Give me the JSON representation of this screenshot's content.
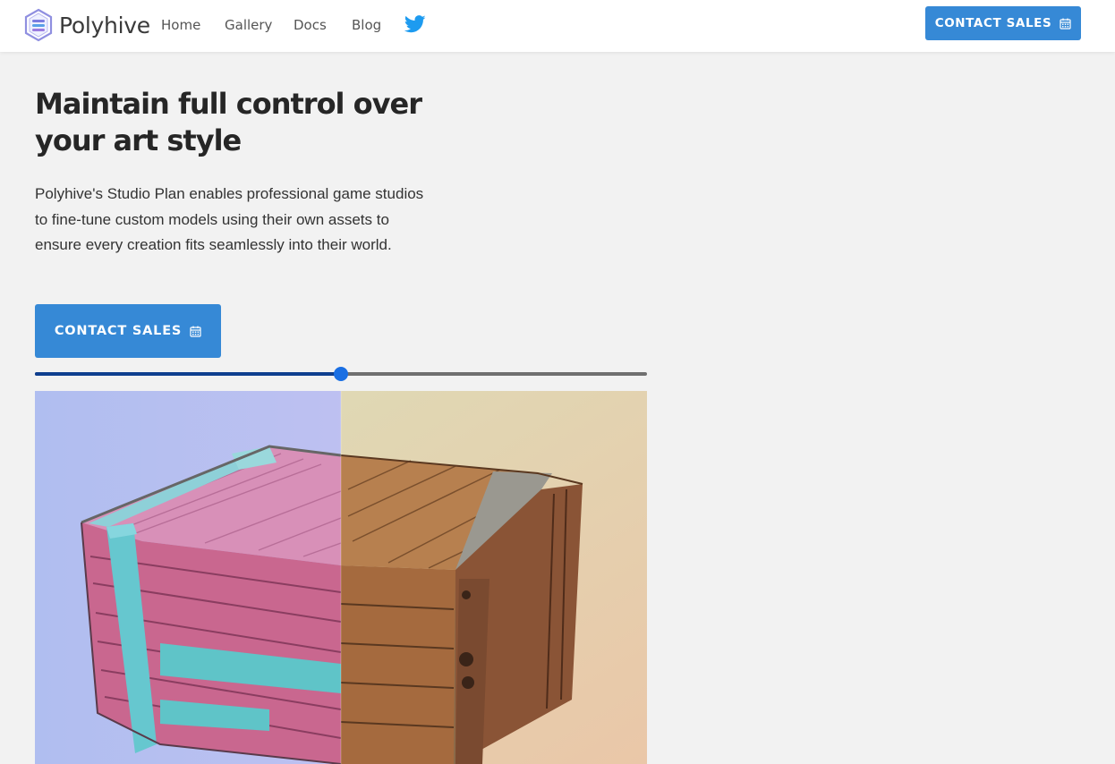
{
  "nav": {
    "brand": "Polyhive",
    "links": [
      "Home",
      "Gallery",
      "Docs",
      "Blog"
    ],
    "cta_label": "CONTACT SALES",
    "cta_icon": "calendar-icon",
    "social_icon": "twitter-icon"
  },
  "hero": {
    "title": "Maintain full control over your art style",
    "description": "Polyhive's Studio Plan enables professional game studios to fine-tune custom models using their own assets to ensure every creation fits seamlessly into their world.",
    "cta_label": "CONTACT SALES",
    "cta_icon": "calendar-icon"
  },
  "comparison": {
    "slider_value": 0.5,
    "left_style": "stylized-pink-teal-crate",
    "right_style": "realistic-wood-crate"
  },
  "colors": {
    "accent": "#3689d6",
    "slider_fill": "#0f3f8f",
    "slider_thumb": "#1a6fe3",
    "twitter": "#1d9bf0",
    "background": "#f2f2f2"
  }
}
